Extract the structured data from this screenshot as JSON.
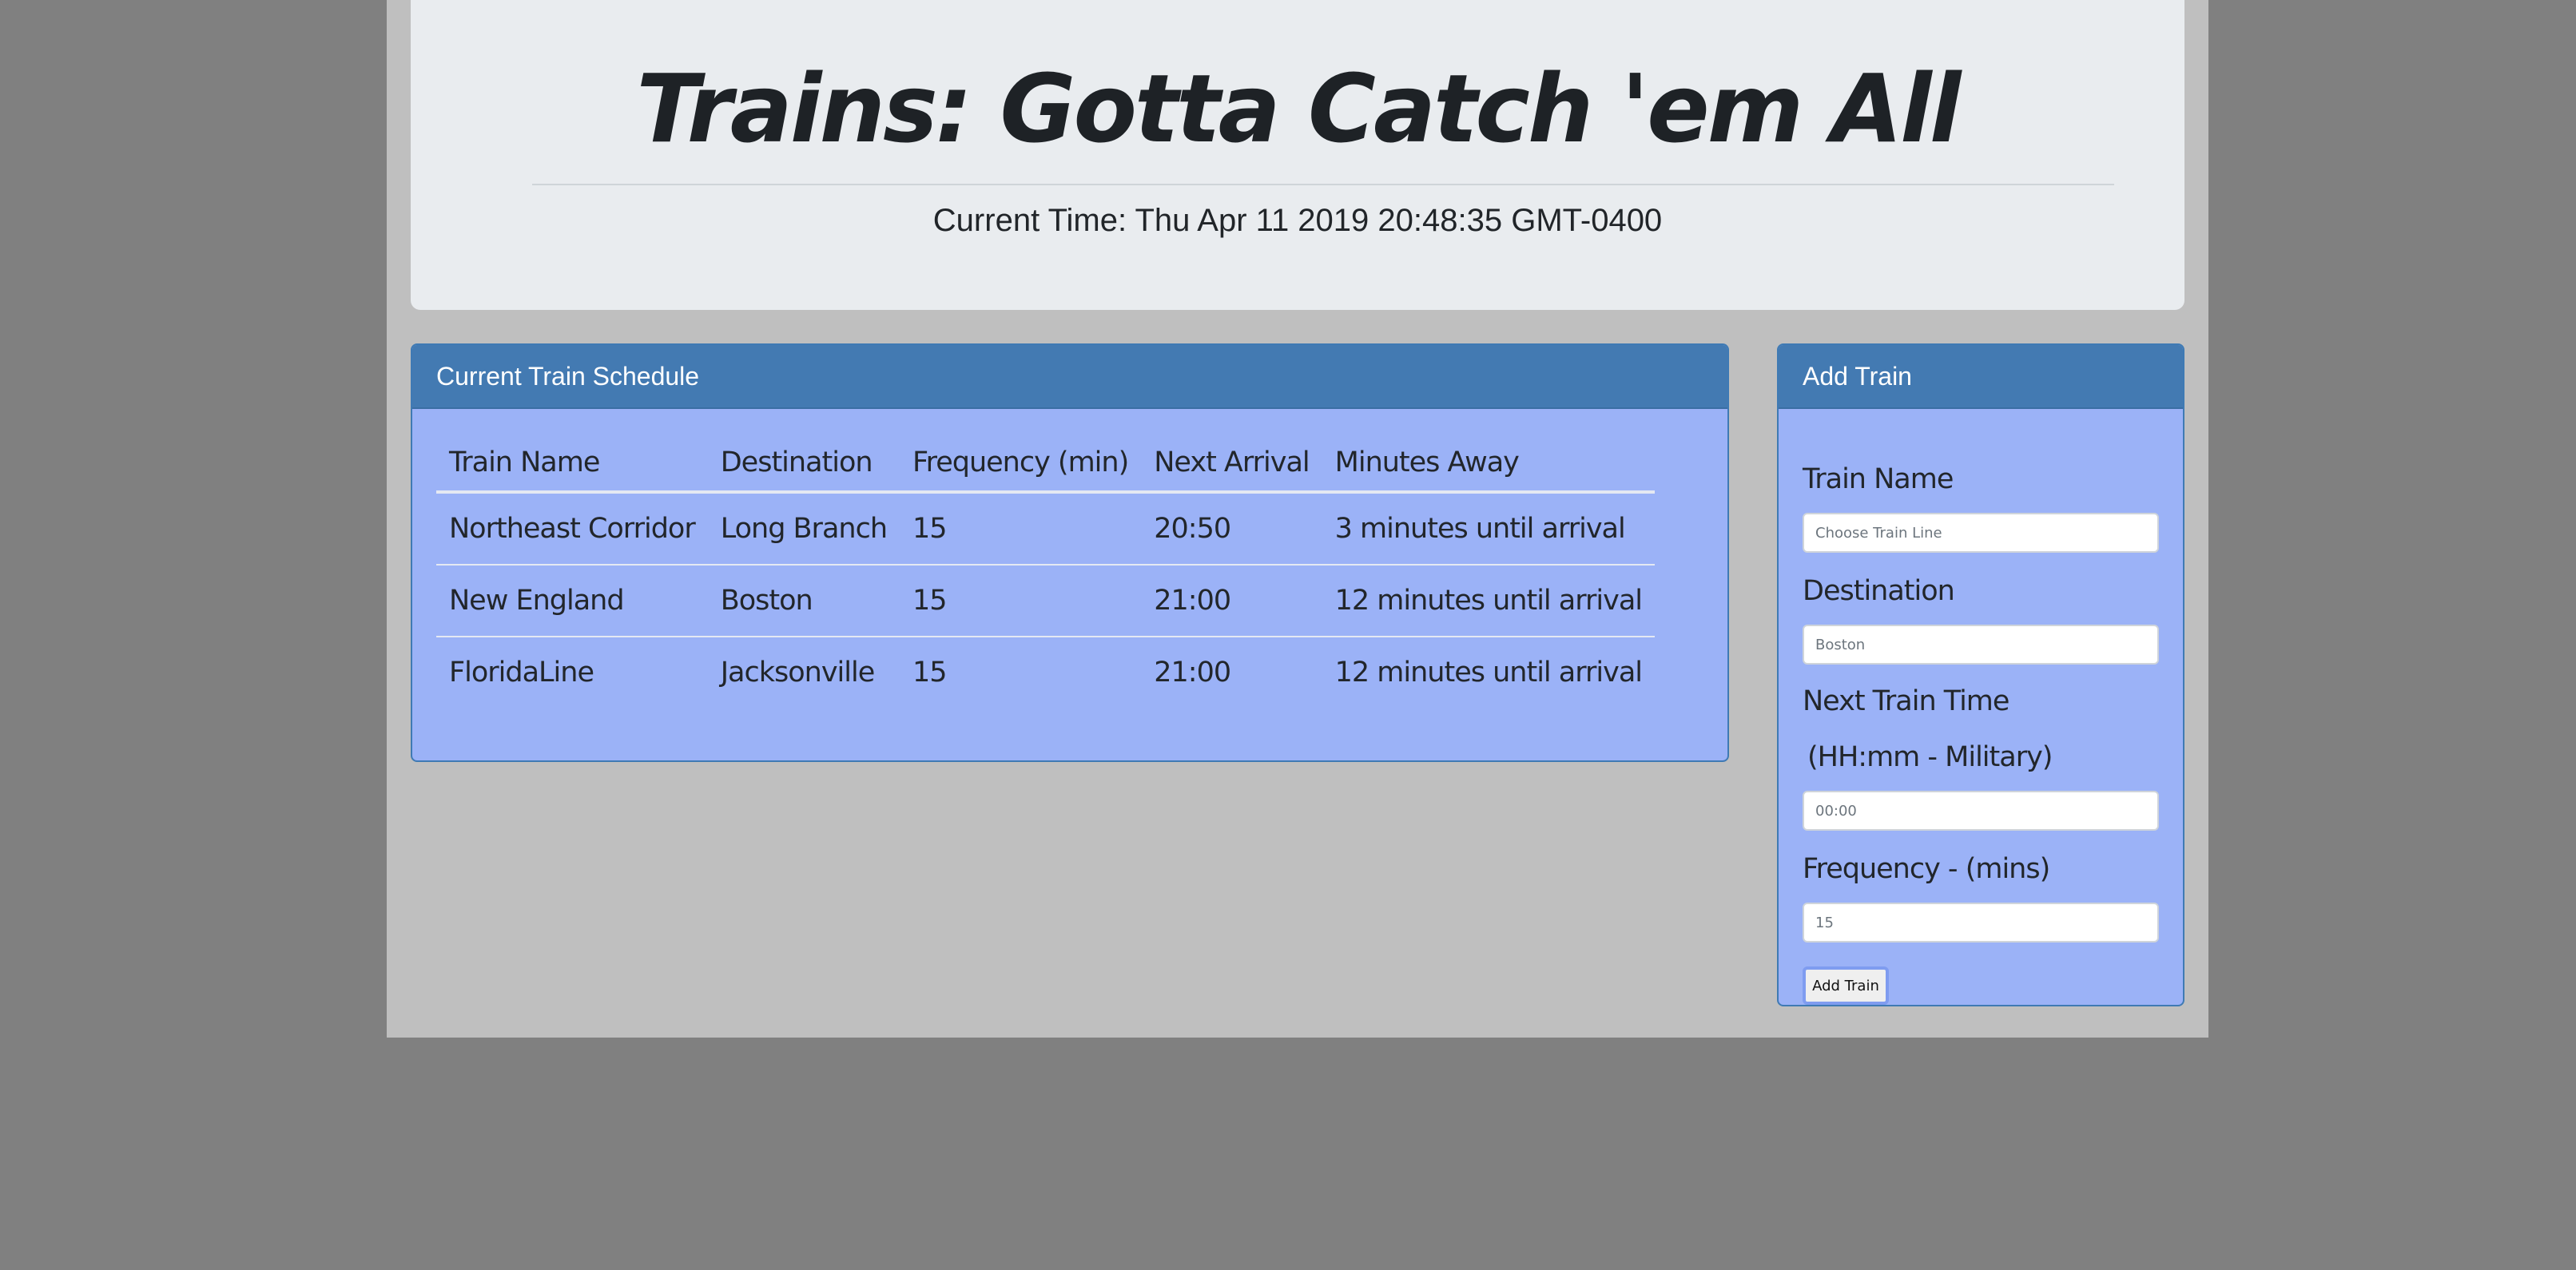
{
  "header": {
    "title": "Trains: Gotta Catch 'em All",
    "current_time": "Current Time: Thu Apr 11 2019 20:48:35 GMT-0400"
  },
  "schedule": {
    "heading": "Current Train Schedule",
    "columns": [
      "Train Name",
      "Destination",
      "Frequency (min)",
      "Next Arrival",
      "Minutes Away"
    ],
    "rows": [
      [
        "Northeast Corridor",
        "Long Branch",
        "15",
        "20:50",
        "3 minutes until arrival"
      ],
      [
        "New England",
        "Boston",
        "15",
        "21:00",
        "12 minutes until arrival"
      ],
      [
        "FloridaLine",
        "Jacksonville",
        "15",
        "21:00",
        "12 minutes until arrival"
      ]
    ]
  },
  "add_train": {
    "heading": "Add Train",
    "train_name_label": "Train Name",
    "train_name_placeholder": "Choose Train Line",
    "destination_label": "Destination",
    "destination_placeholder": "Boston",
    "next_time_label": "Next Train Time",
    "next_time_label_2": "(HH:mm - Military)",
    "next_time_placeholder": "00:00",
    "frequency_label": "Frequency - (mins)",
    "frequency_placeholder": "15",
    "button_label": "Add Train"
  },
  "colors": {
    "page_background": "#808080",
    "container_background": "#bfbfbf",
    "jumbotron_background": "#e9ecef",
    "panel_heading": "#437ab2",
    "panel_body": "#9bb2f7"
  }
}
